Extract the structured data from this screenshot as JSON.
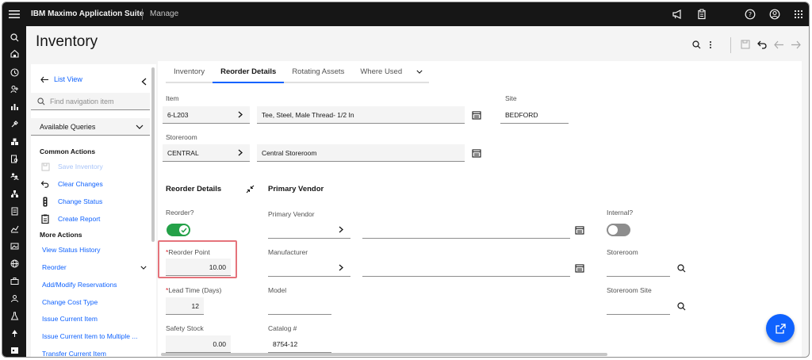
{
  "topbar": {
    "brand": "IBM Maximo Application Suite",
    "app": "Manage"
  },
  "page": {
    "title": "Inventory"
  },
  "nav": {
    "list_view": "List View",
    "search_placeholder": "Find navigation item",
    "queries": "Available Queries",
    "common_actions_title": "Common Actions",
    "common_actions": [
      {
        "label": "Save Inventory",
        "icon": "save-icon",
        "disabled": true
      },
      {
        "label": "Clear Changes",
        "icon": "undo-icon"
      },
      {
        "label": "Change Status",
        "icon": "traffic-light-icon"
      },
      {
        "label": "Create Report",
        "icon": "report-icon"
      }
    ],
    "more_actions_title": "More Actions",
    "more_actions": [
      "View Status History",
      "Reorder",
      "Add/Modify Reservations",
      "Change Cost Type",
      "Issue Current Item",
      "Issue Current Item to Multiple ...",
      "Transfer Current Item"
    ]
  },
  "tabs": [
    "Inventory",
    "Reorder Details",
    "Rotating Assets",
    "Where Used"
  ],
  "active_tab": "Reorder Details",
  "form": {
    "item_label": "Item",
    "item_value": "6-L203",
    "item_desc": "Tee, Steel, Male Thread- 1/2 In",
    "site_label": "Site",
    "site_value": "BEDFORD",
    "storeroom_label": "Storeroom",
    "storeroom_value": "CENTRAL",
    "storeroom_desc": "Central Storeroom"
  },
  "reorder": {
    "title": "Reorder Details",
    "reorder_label": "Reorder?",
    "reorder_point_label": "Reorder Point",
    "reorder_point_value": "10.00",
    "lead_time_label": "Lead Time (Days)",
    "lead_time_value": "12",
    "safety_stock_label": "Safety Stock",
    "safety_stock_value": "0.00"
  },
  "vendor": {
    "title": "Primary Vendor",
    "primary_vendor_label": "Primary Vendor",
    "manufacturer_label": "Manufacturer",
    "model_label": "Model",
    "catalog_label": "Catalog #",
    "catalog_value": "8754-12",
    "internal_label": "Internal?",
    "storeroom_label": "Storeroom",
    "storeroom_site_label": "Storeroom Site"
  },
  "colors": {
    "accent": "#0f62fe",
    "toggle_on": "#24a148",
    "highlight": "#e5737b",
    "required": "#da1e28"
  }
}
